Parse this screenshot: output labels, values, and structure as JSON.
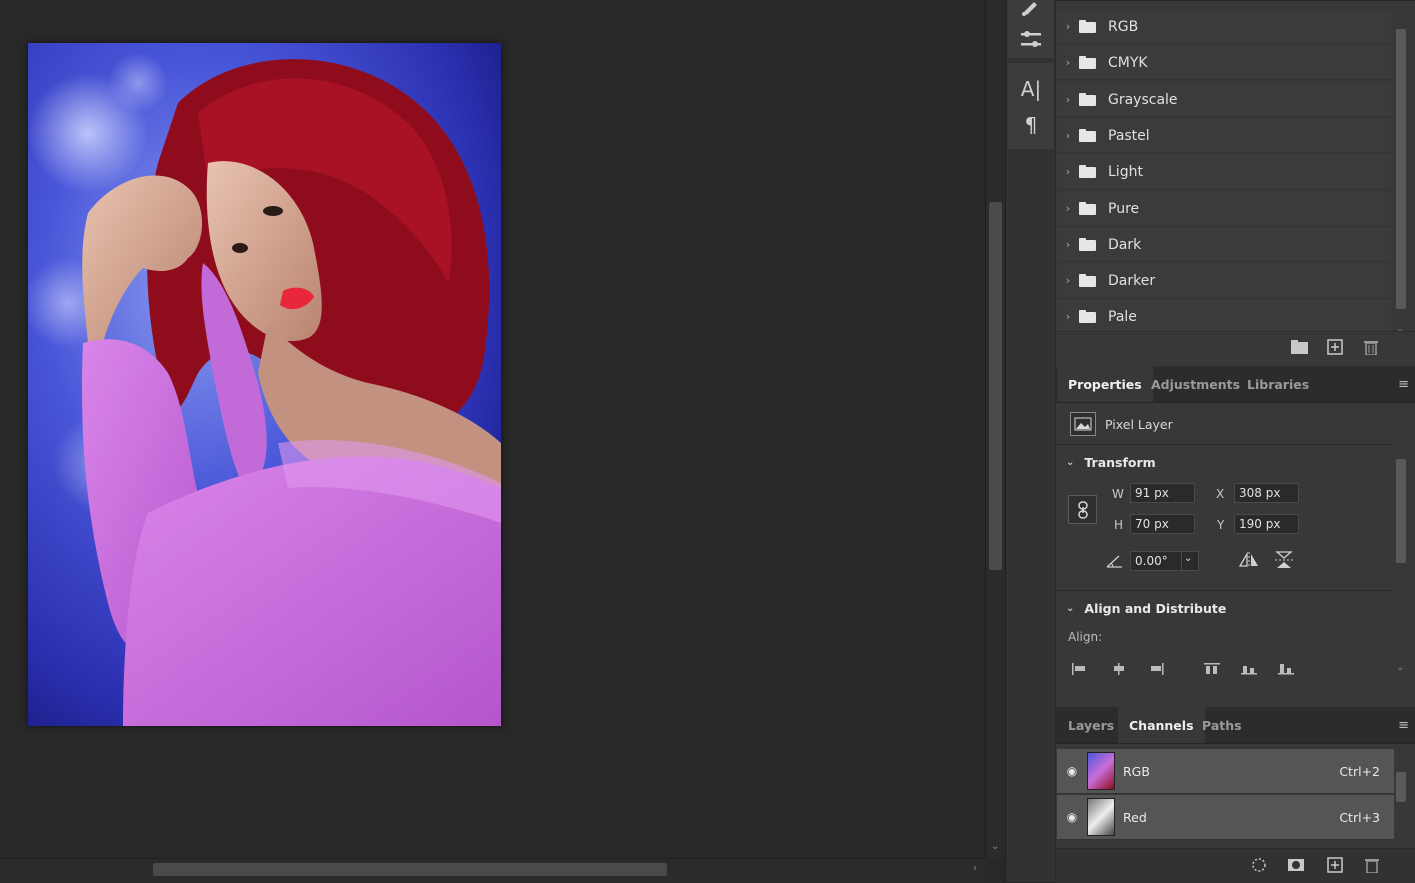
{
  "colors": {
    "app_bg": "#282828",
    "panel_bg": "#383838",
    "active_row": "#555555",
    "hair": "#9c0f1f",
    "sweater": "#c86ed9",
    "background_blue": "#3a46c8"
  },
  "toolbar": {
    "tools": [
      "brush-settings-icon",
      "adjustments-icon",
      "character-icon",
      "paragraph-icon"
    ]
  },
  "swatches": {
    "groups": [
      {
        "label": "RGB"
      },
      {
        "label": "CMYK"
      },
      {
        "label": "Grayscale"
      },
      {
        "label": "Pastel"
      },
      {
        "label": "Light"
      },
      {
        "label": "Pure"
      },
      {
        "label": "Dark"
      },
      {
        "label": "Darker"
      },
      {
        "label": "Pale"
      }
    ]
  },
  "properties": {
    "tabs": [
      "Properties",
      "Adjustments",
      "Libraries"
    ],
    "active_tab": "Properties",
    "layer_kind": "Pixel Layer",
    "transform": {
      "title": "Transform",
      "w_label": "W",
      "w_value": "91 px",
      "h_label": "H",
      "h_value": "70 px",
      "x_label": "X",
      "x_value": "308 px",
      "y_label": "Y",
      "y_value": "190 px",
      "angle_value": "0.00°"
    },
    "align": {
      "title": "Align and Distribute",
      "label": "Align:"
    }
  },
  "channels_panel": {
    "tabs": [
      "Layers",
      "Channels",
      "Paths"
    ],
    "active_tab": "Channels",
    "rows": [
      {
        "name": "RGB",
        "shortcut": "Ctrl+2"
      },
      {
        "name": "Red",
        "shortcut": "Ctrl+3"
      }
    ]
  }
}
